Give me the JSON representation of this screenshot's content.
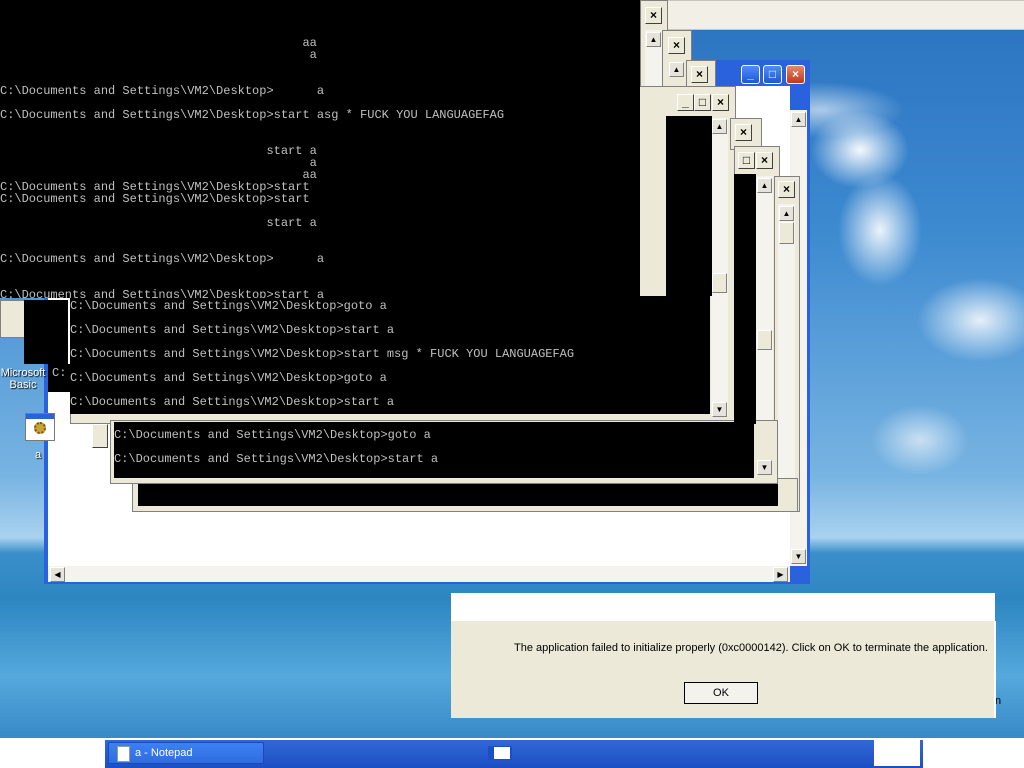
{
  "console_top": {
    "lines": [
      {
        "text": "                                          aa"
      },
      {
        "text": "                                           a"
      },
      {
        "text": ""
      },
      {
        "text": "C:\\Documents and Settings\\VM2\\Desktop>      a"
      },
      {
        "text": ""
      },
      {
        "text": "C:\\Documents and Settings\\VM2\\Desktop>start asg * FUCK YOU LANGUAGEFAG"
      },
      {
        "text": ""
      },
      {
        "text": ""
      },
      {
        "text": "                                     start a"
      },
      {
        "text": "                                           a"
      },
      {
        "text": "                                          aa"
      },
      {
        "text": "C:\\Documents and Settings\\VM2\\Desktop>start"
      },
      {
        "text": "C:\\Documents and Settings\\VM2\\Desktop>start"
      },
      {
        "text": ""
      },
      {
        "text": "                                     start a"
      },
      {
        "text": ""
      },
      {
        "text": ""
      },
      {
        "text": "C:\\Documents and Settings\\VM2\\Desktop>      a"
      },
      {
        "text": ""
      },
      {
        "text": ""
      },
      {
        "text": "C:\\Documents and Settings\\VM2\\Desktop>start a"
      }
    ]
  },
  "console_middle": {
    "lines": [
      "C:\\Documents and Settings\\VM2\\Desktop>goto a",
      "",
      "C:\\Documents and Settings\\VM2\\Desktop>start a",
      "",
      "C:\\Documents and Settings\\VM2\\Desktop>start msg * FUCK YOU LANGUAGEFAG",
      "",
      "C:\\Documents and Settings\\VM2\\Desktop>goto a",
      "",
      "C:\\Documents and Settings\\VM2\\Desktop>start a"
    ]
  },
  "console_lower": {
    "lines": [
      "C:\\Documents and Settings\\VM2\\Desktop>goto a",
      "",
      "C:\\Documents and Settings\\VM2\\Desktop>start a"
    ]
  },
  "desktop": {
    "icon_label_1": "Microsoft",
    "icon_label_1b": "Basic",
    "icon_label_2": "a",
    "small_c": "C:",
    "edge_letter": "n"
  },
  "window_buttons": {
    "minimize": "_",
    "maximize": "□",
    "close": "×",
    "scroll_up": "▲",
    "scroll_down": "▼"
  },
  "dialog": {
    "message": "The application failed to initialize properly (0xc0000142). Click on OK to terminate the application.",
    "ok_label": "OK"
  },
  "taskbar": {
    "notepad_task": "a - Notepad"
  },
  "colors": {
    "console_bg": "#000000",
    "console_text": "#c0c0c0",
    "xp_blue": "#2a62dd",
    "taskbar_blue": "#245edb"
  }
}
